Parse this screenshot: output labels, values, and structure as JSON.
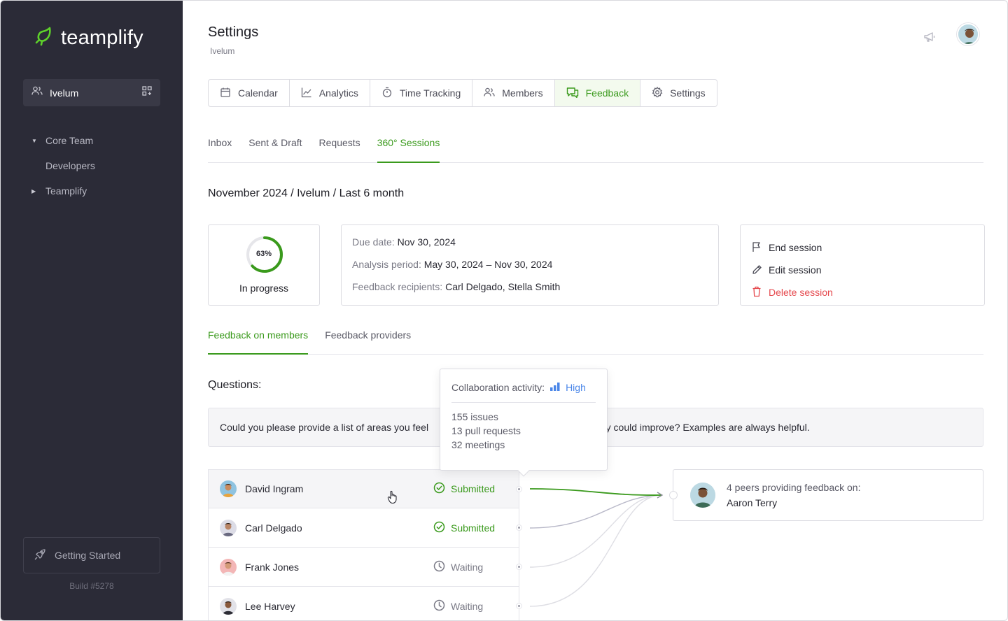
{
  "brand": {
    "name": "teamplify",
    "accent": "#3a9a1c"
  },
  "sidebar": {
    "workspace": "Ivelum",
    "tree": [
      {
        "label": "Core Team",
        "caret": "▼"
      },
      {
        "label": "Developers",
        "caret": ""
      },
      {
        "label": "Teamplify",
        "caret": "▶"
      }
    ],
    "getting_started": "Getting Started",
    "build": "Build #5278"
  },
  "header": {
    "title": "Settings",
    "subtitle": "Ivelum"
  },
  "nav": [
    {
      "label": "Calendar",
      "icon": "calendar-icon"
    },
    {
      "label": "Analytics",
      "icon": "chart-line-icon"
    },
    {
      "label": "Time Tracking",
      "icon": "stopwatch-icon"
    },
    {
      "label": "Members",
      "icon": "users-icon"
    },
    {
      "label": "Feedback",
      "icon": "chat-icon",
      "active": true
    },
    {
      "label": "Settings",
      "icon": "gear-icon"
    }
  ],
  "subtabs": [
    "Inbox",
    "Sent & Draft",
    "Requests",
    "360° Sessions"
  ],
  "breadcrumb": "November 2024 / Ivelum / Last 6 month",
  "progress": {
    "percent_label": "63%",
    "percent": 63,
    "status": "In progress"
  },
  "info": {
    "due_label": "Due date:",
    "due_value": "Nov 30, 2024",
    "period_label": "Analysis period:",
    "period_value": "May 30, 2024 – Nov 30, 2024",
    "recipients_label": "Feedback recipients:",
    "recipients_value": "Carl Delgado, Stella Smith"
  },
  "actions": {
    "end": "End session",
    "edit": "Edit session",
    "delete": "Delete session"
  },
  "feedback_tabs": [
    "Feedback on members",
    "Feedback providers"
  ],
  "questions": {
    "title": "Questions:",
    "text_left": "Could you please provide a list of areas you feel",
    "text_right": "hey could improve? Examples are always helpful."
  },
  "people": [
    {
      "name": "David Ingram",
      "status": "Submitted",
      "state": "ok"
    },
    {
      "name": "Carl Delgado",
      "status": "Submitted",
      "state": "ok"
    },
    {
      "name": "Frank Jones",
      "status": "Waiting",
      "state": "wait"
    },
    {
      "name": "Lee Harvey",
      "status": "Waiting",
      "state": "wait"
    }
  ],
  "tooltip": {
    "label": "Collaboration activity:",
    "level": "High",
    "issues": "155 issues",
    "prs": "13 pull requests",
    "meetings": "32 meetings"
  },
  "peer": {
    "line1": "4 peers providing feedback on:",
    "line2": "Aaron Terry"
  }
}
